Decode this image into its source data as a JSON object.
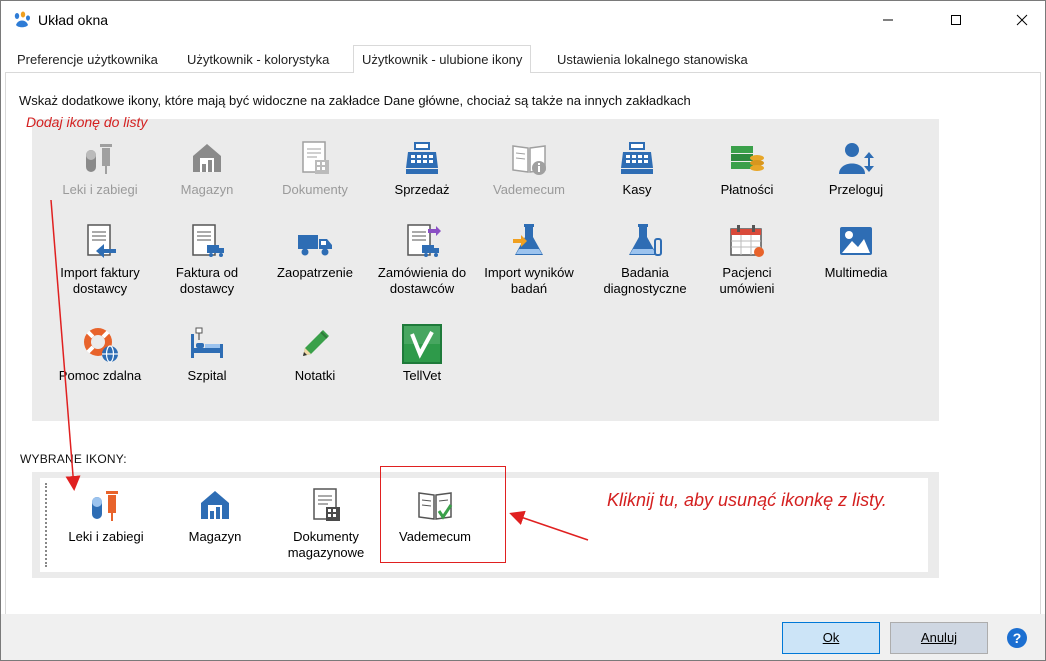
{
  "window": {
    "title": "Układ okna"
  },
  "tabs": [
    {
      "label": "Preferencje użytkownika"
    },
    {
      "label": "Użytkownik - kolorystyka"
    },
    {
      "label": "Użytkownik - ulubione ikony"
    },
    {
      "label": "Ustawienia lokalnego stanowiska"
    }
  ],
  "active_tab_index": 2,
  "instruction": "Wskaż dodatkowe ikony, które mają być widoczne na zakładce Dane główne, chociaż są także na innych zakładkach",
  "annotations": {
    "add_hint": "Dodaj ikonę do listy",
    "remove_hint": "Kliknij tu, aby usunąć ikonkę z listy.",
    "color": "#d42020"
  },
  "available_icons": [
    {
      "line1": "Leki i zabiegi",
      "line2": "",
      "icon": "drug-syringe-icon",
      "disabled": true
    },
    {
      "line1": "Magazyn",
      "line2": "",
      "icon": "warehouse-icon",
      "disabled": true
    },
    {
      "line1": "Dokumenty",
      "line2": "",
      "icon": "document-icon",
      "disabled": true
    },
    {
      "line1": "Sprzedaż",
      "line2": "",
      "icon": "cash-register-icon",
      "disabled": false
    },
    {
      "line1": "Vademecum",
      "line2": "",
      "icon": "book-info-icon",
      "disabled": true
    },
    {
      "line1": "Kasy",
      "line2": "",
      "icon": "cash-register-icon",
      "disabled": false
    },
    {
      "line1": "Płatności",
      "line2": "",
      "icon": "money-stack-icon",
      "disabled": false
    },
    {
      "line1": "Przeloguj",
      "line2": "",
      "icon": "user-switch-icon",
      "disabled": false
    },
    {
      "line1": "Import faktury",
      "line2": "dostawcy",
      "icon": "invoice-import-icon",
      "disabled": false
    },
    {
      "line1": "Faktura od",
      "line2": "dostawcy",
      "icon": "invoice-truck-icon",
      "disabled": false
    },
    {
      "line1": "Zaopatrzenie",
      "line2": "",
      "icon": "truck-icon",
      "disabled": false
    },
    {
      "line1": "Zamówienia do",
      "line2": "dostawców",
      "icon": "order-icon",
      "disabled": false
    },
    {
      "line1": "Import wyników",
      "line2": "badań",
      "icon": "flask-import-icon",
      "disabled": false
    },
    {
      "line1": "Badania",
      "line2": "diagnostyczne",
      "icon": "flask-icon",
      "disabled": false
    },
    {
      "line1": "Pacjenci",
      "line2": "umówieni",
      "icon": "calendar-icon",
      "disabled": false
    },
    {
      "line1": "Multimedia",
      "line2": "",
      "icon": "image-icon",
      "disabled": false
    },
    {
      "line1": "Pomoc zdalna",
      "line2": "",
      "icon": "lifebuoy-icon",
      "disabled": false
    },
    {
      "line1": "Szpital",
      "line2": "",
      "icon": "hospital-bed-icon",
      "disabled": false
    },
    {
      "line1": "Notatki",
      "line2": "",
      "icon": "pencil-icon",
      "disabled": false
    },
    {
      "line1": "TellVet",
      "line2": "",
      "icon": "tellvet-logo-icon",
      "disabled": false
    }
  ],
  "chosen_label": "WYBRANE IKONY:",
  "chosen_icons": [
    {
      "line1": "Leki i zabiegi",
      "line2": "",
      "icon": "drug-syringe-icon"
    },
    {
      "line1": "Magazyn",
      "line2": "",
      "icon": "warehouse-icon"
    },
    {
      "line1": "Dokumenty",
      "line2": "magazynowe",
      "icon": "document-icon"
    },
    {
      "line1": "Vademecum",
      "line2": "",
      "icon": "book-check-icon"
    }
  ],
  "buttons": {
    "ok": "Ok",
    "cancel": "Anuluj"
  },
  "colors": {
    "accent": "#2e6db4",
    "highlight_border": "#e02020",
    "ok_button_bg": "#cce4f7",
    "ok_button_border": "#0078d7"
  }
}
